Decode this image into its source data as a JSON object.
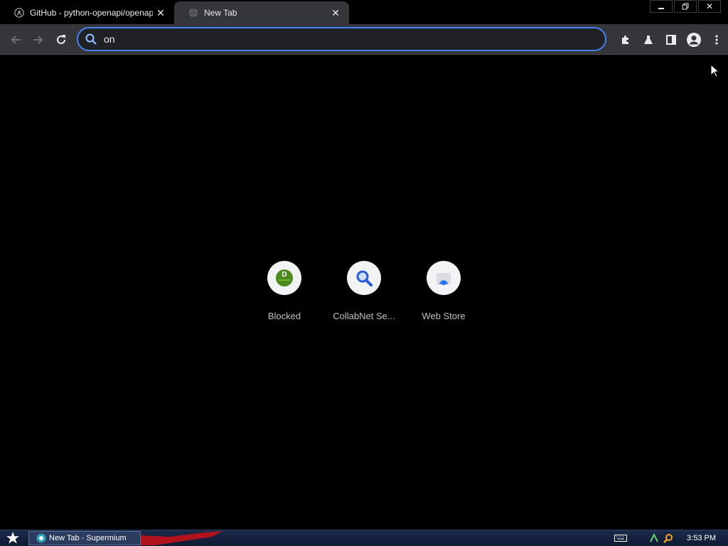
{
  "tabs": [
    {
      "title": "GitHub - python-openapi/openapi-c",
      "favicon": "github-icon",
      "active": false
    },
    {
      "title": "New Tab",
      "favicon": "globe-icon",
      "active": true
    }
  ],
  "omnibox": {
    "value": "on",
    "icon": "search-icon"
  },
  "toolbar_icons": [
    "back-icon",
    "forward-icon",
    "reload-icon",
    "extensions-icon",
    "labs-icon",
    "side-panel-icon",
    "profile-icon",
    "menu-icon"
  ],
  "shortcuts": [
    {
      "label": "Blocked",
      "icon": "blocked-site-icon"
    },
    {
      "label": "CollabNet Se...",
      "icon": "search-icon"
    },
    {
      "label": "Web Store",
      "icon": "web-store-icon"
    }
  ],
  "taskbar": {
    "task_label": "New Tab - Supermium",
    "clock": "3:53 PM"
  },
  "colors": {
    "accent": "#4a80f5",
    "toolbar": "#35363a",
    "background": "#000000"
  }
}
